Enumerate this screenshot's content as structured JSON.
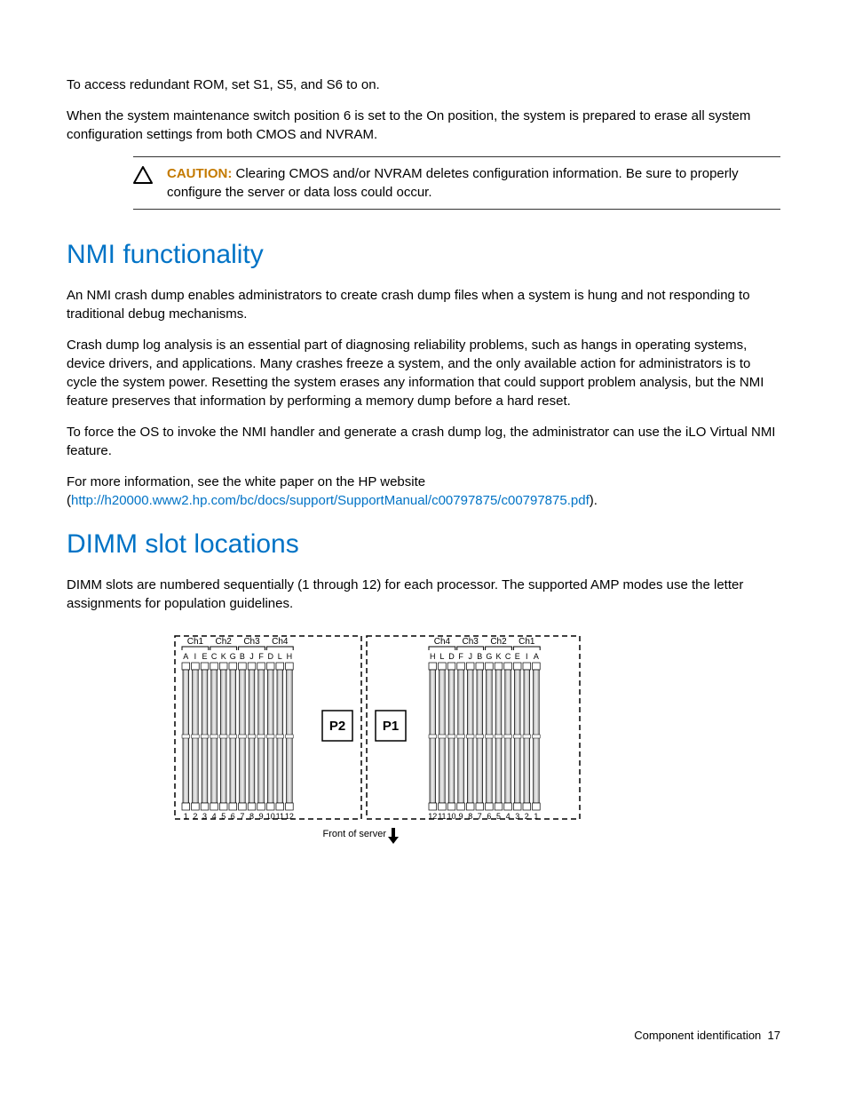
{
  "intro": {
    "p1": "To access redundant ROM, set S1, S5, and S6 to on.",
    "p2": "When the system maintenance switch position 6 is set to the On position, the system is prepared to erase all system configuration settings from both CMOS and NVRAM."
  },
  "caution": {
    "label": "CAUTION:",
    "text": "Clearing CMOS and/or NVRAM deletes configuration information. Be sure to properly configure the server or data loss could occur."
  },
  "nmi": {
    "heading": "NMI functionality",
    "p1": "An NMI crash dump enables administrators to create crash dump files when a system is hung and not responding to traditional debug mechanisms.",
    "p2": "Crash dump log analysis is an essential part of diagnosing reliability problems, such as hangs in operating systems, device drivers, and applications. Many crashes freeze a system, and the only available action for administrators is to cycle the system power. Resetting the system erases any information that could support problem analysis, but the NMI feature preserves that information by performing a memory dump before a hard reset.",
    "p3": "To force the OS to invoke the NMI handler and generate a crash dump log, the administrator can use the iLO Virtual NMI feature.",
    "p4_prefix": "For more information, see the white paper on the HP website (",
    "p4_link": "http://h20000.www2.hp.com/bc/docs/support/SupportManual/c00797875/c00797875.pdf",
    "p4_suffix": ")."
  },
  "dimm": {
    "heading": "DIMM slot locations",
    "p1": "DIMM slots are numbered sequentially (1 through 12) for each processor. The supported AMP modes use the letter assignments for population guidelines.",
    "diagram": {
      "p2_channels": [
        "Ch1",
        "Ch2",
        "Ch3",
        "Ch4"
      ],
      "p1_channels": [
        "Ch4",
        "Ch3",
        "Ch2",
        "Ch1"
      ],
      "p2_letters": [
        "A",
        "I",
        "E",
        "C",
        "K",
        "G",
        "B",
        "J",
        "F",
        "D",
        "L",
        "H"
      ],
      "p1_letters": [
        "H",
        "L",
        "D",
        "F",
        "J",
        "B",
        "G",
        "K",
        "C",
        "E",
        "I",
        "A"
      ],
      "p2_numbers": [
        "1",
        "2",
        "3",
        "4",
        "5",
        "6",
        "7",
        "8",
        "9",
        "10",
        "11",
        "12"
      ],
      "p1_numbers": [
        "12",
        "11",
        "10",
        "9",
        "8",
        "7",
        "6",
        "5",
        "4",
        "3",
        "2",
        "1"
      ],
      "proc_labels": {
        "left": "P2",
        "right": "P1"
      },
      "front_label": "Front of server"
    }
  },
  "footer": {
    "section": "Component identification",
    "page": "17"
  }
}
